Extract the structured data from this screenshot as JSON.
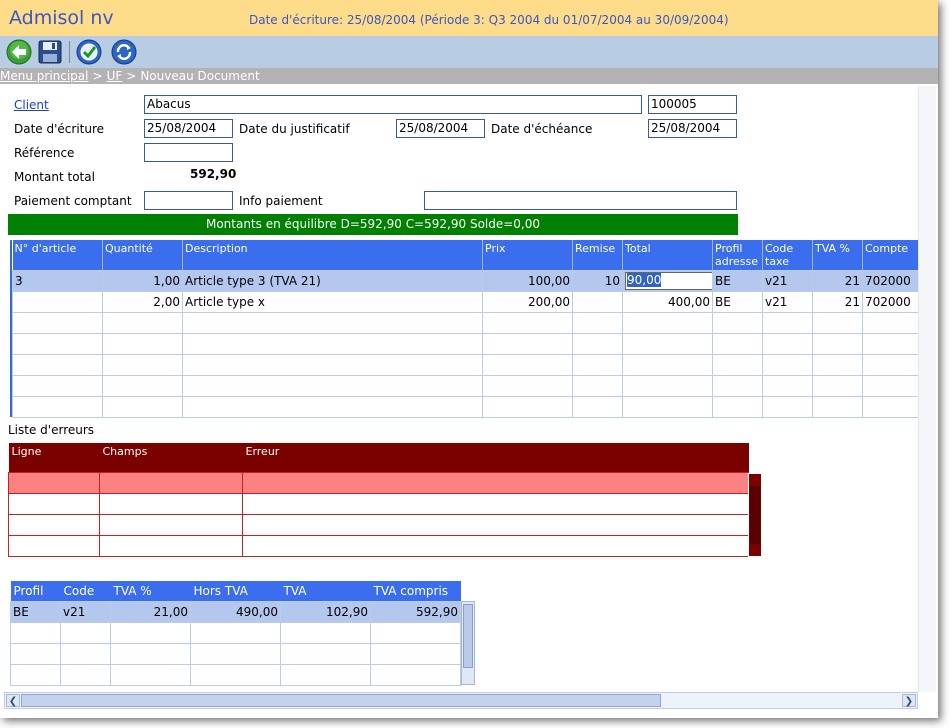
{
  "app": {
    "title": "Admisol nv",
    "date_info": "Date d'écriture: 25/08/2004 (Période 3: Q3 2004 du 01/07/2004 au 30/09/2004)"
  },
  "toolbar": {
    "buttons": [
      "back-icon",
      "save-icon",
      "validate-icon",
      "refresh-icon"
    ]
  },
  "breadcrumb": {
    "items": [
      "Menu principal",
      "UF",
      "Nouveau Document"
    ],
    "separator": ">"
  },
  "form": {
    "client_label": "Client",
    "client_value": "Abacus",
    "client_code": "100005",
    "date_ecriture_label": "Date d'écriture",
    "date_ecriture": "25/08/2004",
    "date_justificatif_label": "Date du justificatif",
    "date_justificatif": "25/08/2004",
    "date_echeance_label": "Date d'échéance",
    "date_echeance": "25/08/2004",
    "reference_label": "Référence",
    "reference": "",
    "montant_label": "Montant total",
    "montant": "592,90",
    "paiement_label": "Paiement comptant",
    "paiement": "",
    "info_label": "Info paiement",
    "info": ""
  },
  "balance": {
    "text": "Montants en équilibre D=592,90 C=592,90 Solde=0,00",
    "color": "#008000"
  },
  "articles": {
    "headers": [
      "N° d'article",
      "Quantité",
      "Description",
      "Prix",
      "Remise",
      "Total",
      "Profil adresse",
      "Code taxe",
      "TVA %",
      "Compte"
    ],
    "rows": [
      [
        "3",
        "1,00",
        "Article type 3 (TVA 21)",
        "100,00",
        "10",
        "90,00",
        "BE",
        "v21",
        "21",
        "702000"
      ],
      [
        "",
        "2,00",
        "Article type x",
        "200,00",
        "",
        "400,00",
        "BE",
        "v21",
        "21",
        "702000"
      ],
      [
        "",
        "",
        "",
        "",
        "",
        "",
        "",
        "",
        "",
        ""
      ],
      [
        "",
        "",
        "",
        "",
        "",
        "",
        "",
        "",
        "",
        ""
      ],
      [
        "",
        "",
        "",
        "",
        "",
        "",
        "",
        "",
        "",
        ""
      ],
      [
        "",
        "",
        "",
        "",
        "",
        "",
        "",
        "",
        "",
        ""
      ],
      [
        "",
        "",
        "",
        "",
        "",
        "",
        "",
        "",
        "",
        ""
      ]
    ]
  },
  "errors": {
    "title": "Liste d'erreurs",
    "headers": [
      "Ligne",
      "Champs",
      "Erreur"
    ],
    "rows": [
      [
        "",
        "",
        ""
      ],
      [
        "",
        "",
        ""
      ],
      [
        "",
        "",
        ""
      ],
      [
        "",
        "",
        ""
      ]
    ]
  },
  "vat": {
    "headers": [
      "Profil",
      "Code",
      "TVA %",
      "Hors TVA",
      "TVA",
      "TVA compris"
    ],
    "rows": [
      [
        "BE",
        "v21",
        "21,00",
        "490,00",
        "102,90",
        "592,90"
      ],
      [
        "",
        "",
        "",
        "",
        "",
        ""
      ],
      [
        "",
        "",
        "",
        "",
        "",
        ""
      ],
      [
        "",
        "",
        "",
        "",
        "",
        ""
      ]
    ]
  },
  "colors": {
    "title_bg": "#fedc8a",
    "header_blue": "#3a6eee",
    "error_header": "#7b0000",
    "selected_row": "#b3c7ef"
  }
}
